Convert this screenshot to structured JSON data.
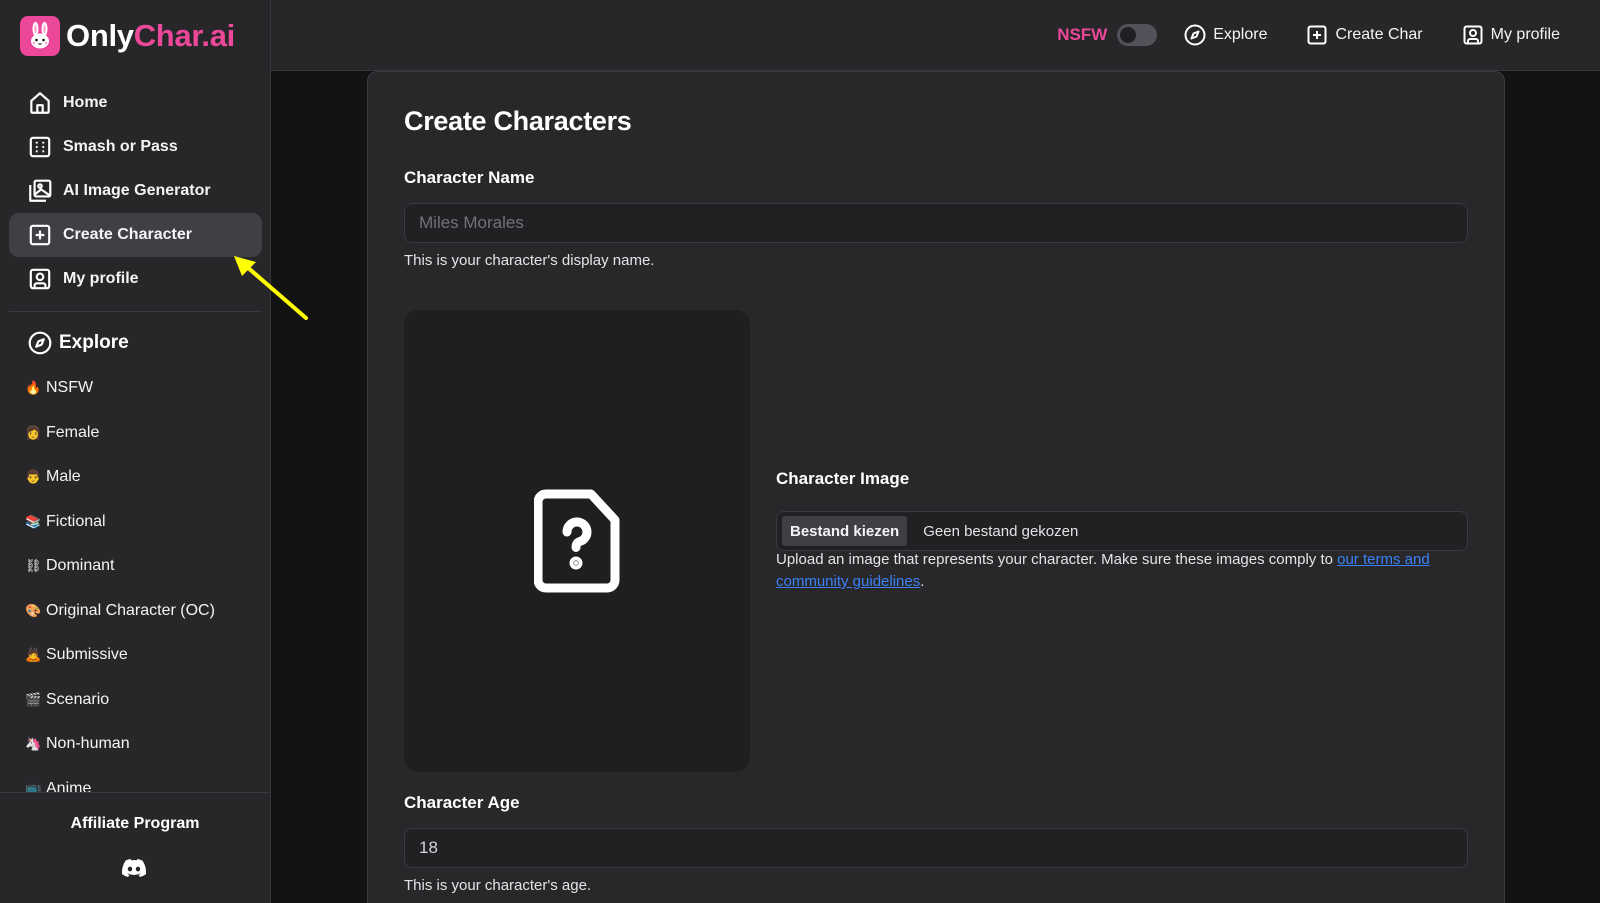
{
  "brand": {
    "name_primary": "Only",
    "name_accent": "Char.ai",
    "accent_color": "#ec4899",
    "logo_icon": "bunny-icon"
  },
  "sidebar": {
    "nav": [
      {
        "label": "Home",
        "icon": "home-icon",
        "active": false
      },
      {
        "label": "Smash or Pass",
        "icon": "dice-grid-icon",
        "active": false
      },
      {
        "label": "AI Image Generator",
        "icon": "image-gallery-icon",
        "active": false
      },
      {
        "label": "Create Character",
        "icon": "plus-square-icon",
        "active": true
      },
      {
        "label": "My profile",
        "icon": "user-square-icon",
        "active": false
      }
    ],
    "explore_heading": "Explore",
    "categories": [
      {
        "emoji": "🔥",
        "label": "NSFW"
      },
      {
        "emoji": "👩",
        "label": "Female"
      },
      {
        "emoji": "👨",
        "label": "Male"
      },
      {
        "emoji": "📚",
        "label": "Fictional"
      },
      {
        "emoji": "⛓",
        "label": "Dominant"
      },
      {
        "emoji": "🎨",
        "label": "Original Character (OC)"
      },
      {
        "emoji": "🙇",
        "label": "Submissive"
      },
      {
        "emoji": "🎬",
        "label": "Scenario"
      },
      {
        "emoji": "🦄",
        "label": "Non-human"
      },
      {
        "emoji": "📺",
        "label": "Anime"
      }
    ],
    "affiliate_label": "Affiliate Program",
    "discord_icon": "discord-icon"
  },
  "topbar": {
    "nsfw_label": "NSFW",
    "nsfw_enabled": false,
    "links": [
      {
        "label": "Explore",
        "icon": "compass-icon"
      },
      {
        "label": "Create Char",
        "icon": "plus-square-icon"
      },
      {
        "label": "My profile",
        "icon": "user-square-icon"
      }
    ]
  },
  "form": {
    "title": "Create Characters",
    "name": {
      "label": "Character Name",
      "placeholder": "Miles Morales",
      "value": "",
      "help": "This is your character's display name."
    },
    "image": {
      "label": "Character Image",
      "button_label": "Bestand kiezen",
      "status": "Geen bestand gekozen",
      "help_prefix": "Upload an image that represents your character. Make sure these images comply to ",
      "help_link": "our terms and community guidelines",
      "help_suffix": ".",
      "preview_icon": "file-question-icon"
    },
    "age": {
      "label": "Character Age",
      "value": "18",
      "help": "This is your character's age."
    }
  },
  "annotation": {
    "type": "arrow",
    "color": "#ffff00",
    "points_to": "Create Character"
  }
}
